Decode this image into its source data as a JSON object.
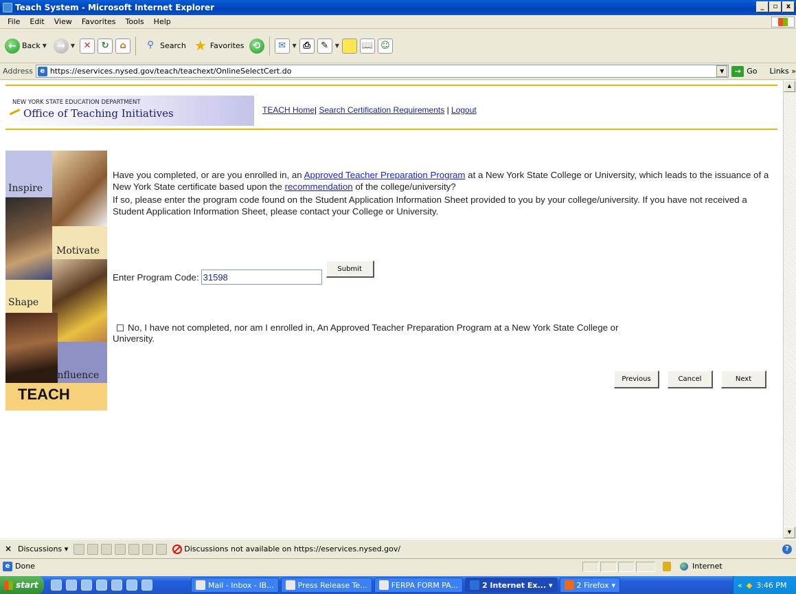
{
  "window": {
    "title": "Teach System - Microsoft Internet Explorer",
    "controls": [
      "_",
      "▫",
      "x"
    ]
  },
  "menu": [
    "File",
    "Edit",
    "View",
    "Favorites",
    "Tools",
    "Help"
  ],
  "toolbar": {
    "back": "Back",
    "search": "Search",
    "favorites": "Favorites"
  },
  "address": {
    "label": "Address",
    "url": "https://eservices.nysed.gov/teach/teachext/OnlineSelectCert.do",
    "go": "Go",
    "links": "Links"
  },
  "header": {
    "dept": "NEW YORK STATE EDUCATION DEPARTMENT",
    "office": "Office of Teaching Initiatives",
    "nav": [
      "TEACH Home",
      "Search Certification Requirements",
      "Logout"
    ],
    "sep1": "|",
    "sep2": " | ",
    "sep3": " | "
  },
  "sidebar": {
    "words": [
      "Inspire",
      "Motivate",
      "Shape",
      "Influence"
    ],
    "brand": "TEACH"
  },
  "main": {
    "q_part1": "Have you completed, or are you enrolled in, an ",
    "q_link1": "Approved Teacher Preparation Program",
    "q_part2": " at a New York State College or University, which leads to the issuance of a New York State certificate based upon the ",
    "q_link2": "recommendation",
    "q_part3": " of the college/university?",
    "instruction": "If so, please enter the program code found on the Student Application Information Sheet provided to you by your college/university. If you have not received a Student Application Information Sheet, please contact your College or University.",
    "code_label": "Enter Program Code:",
    "code_value": "31598",
    "submit": "Submit",
    "no_option": "No, I have not completed, nor am I enrolled in, An Approved Teacher Preparation Program at a New York State College or University.",
    "buttons": {
      "previous": "Previous",
      "cancel": "Cancel",
      "next": "Next"
    }
  },
  "discussions": {
    "label": "Discussions",
    "message": "Discussions not available on https://eservices.nysed.gov/"
  },
  "status": {
    "text": "Done",
    "zone": "Internet"
  },
  "taskbar": {
    "start": "start",
    "tasks": [
      "Mail - Inbox - IB...",
      "Press Release Te...",
      "FERPA FORM PA...",
      "2 Internet Ex...",
      "2 Firefox"
    ],
    "time": "3:46 PM"
  }
}
